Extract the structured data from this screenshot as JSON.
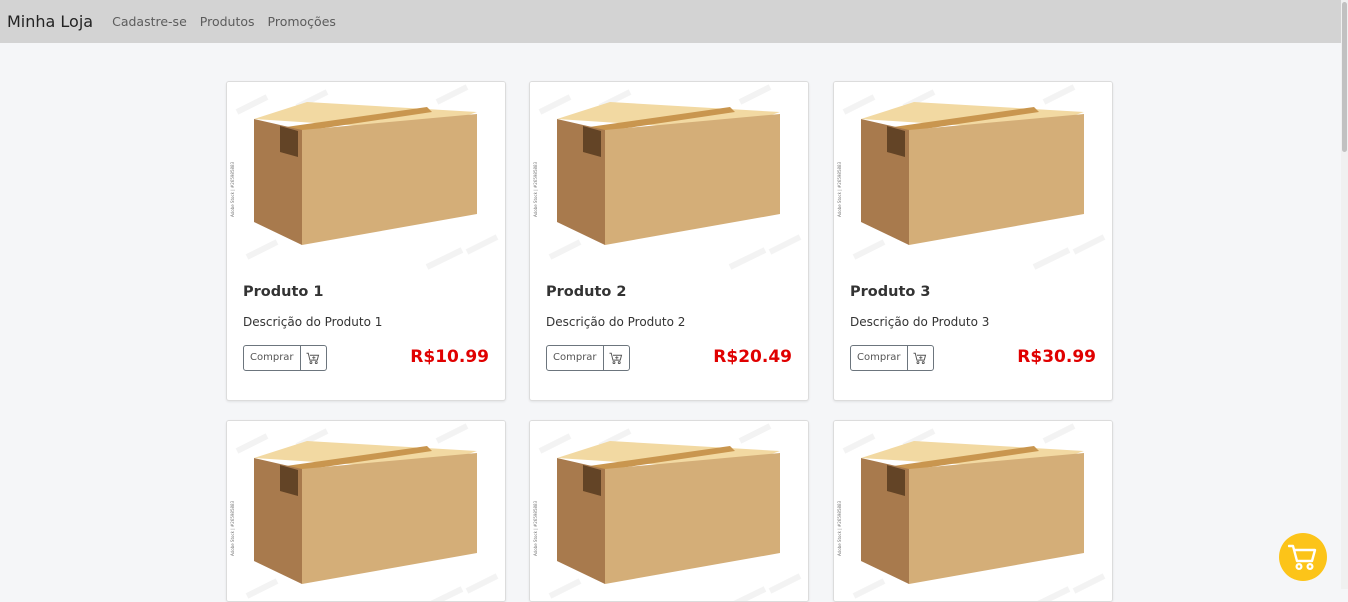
{
  "navbar": {
    "brand": "Minha Loja",
    "links": [
      "Cadastre-se",
      "Produtos",
      "Promoções"
    ]
  },
  "products": [
    {
      "name": "Produto 1",
      "description": "Descrição do Produto 1",
      "price": "R$10.99",
      "buy_label": "Comprar"
    },
    {
      "name": "Produto 2",
      "description": "Descrição do Produto 2",
      "price": "R$20.49",
      "buy_label": "Comprar"
    },
    {
      "name": "Produto 3",
      "description": "Descrição do Produto 3",
      "price": "R$30.99",
      "buy_label": "Comprar"
    },
    {
      "name": "",
      "description": "",
      "price": "",
      "buy_label": ""
    },
    {
      "name": "",
      "description": "",
      "price": "",
      "buy_label": ""
    },
    {
      "name": "",
      "description": "",
      "price": "",
      "buy_label": ""
    }
  ],
  "image_watermark": "Adobe Stock | #265985883",
  "colors": {
    "navbar_bg": "#d3d3d3",
    "price": "#e00000",
    "fab_bg": "#fcc419",
    "page_bg": "#f5f6f8"
  },
  "icons": {
    "product_image": "cardboard-box",
    "cart_button": "cart-icon",
    "floating_cart": "cart-icon"
  }
}
